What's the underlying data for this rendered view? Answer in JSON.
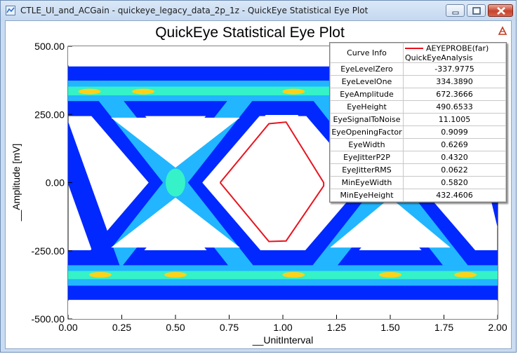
{
  "window": {
    "title": "CTLE_UI_and_ACGain - quickeye_legacy_data_2p_1z - QuickEye Statistical Eye Plot"
  },
  "chart_data": {
    "type": "heatmap",
    "title": "QuickEye Statistical Eye Plot",
    "xlabel": "__UnitInterval",
    "ylabel": "__Amplitude [mV]",
    "xlim": [
      0.0,
      2.0
    ],
    "ylim": [
      -500.0,
      500.0
    ],
    "xticks": [
      "0.00",
      "0.25",
      "0.50",
      "0.75",
      "1.00",
      "1.25",
      "1.50",
      "1.75",
      "2.00"
    ],
    "yticks": [
      "500.00",
      "250.00",
      "0.00",
      "-250.00",
      "-500.00"
    ],
    "grid": false,
    "colors": {
      "background": "#ffffff",
      "level_low": "#0028ff",
      "level_mid": "#21b6ff",
      "level_high": "#35f2c8",
      "level_peak": "#ffd21a",
      "contour": "#e8141f"
    },
    "series": [
      {
        "name": "AEYEPROBE(far)",
        "type": "contour",
        "x": [
          0.708,
          0.935,
          1.015,
          1.19,
          1.19,
          1.015,
          0.935,
          0.708
        ],
        "y": [
          0.0,
          216.0,
          222.0,
          0.0,
          -12.0,
          -214.0,
          -216.0,
          0.0
        ]
      }
    ],
    "legend": {
      "position": "top-right",
      "entry": "AEYEPROBE(far)",
      "sub_entry": "QuickEyeAnalysis"
    }
  },
  "info_table": {
    "header_label": "Curve Info",
    "rows": [
      {
        "name": "EyeLevelZero",
        "value": "-337.9775"
      },
      {
        "name": "EyeLevelOne",
        "value": "334.3890"
      },
      {
        "name": "EyeAmplitude",
        "value": "672.3666"
      },
      {
        "name": "EyeHeight",
        "value": "490.6533"
      },
      {
        "name": "EyeSignalToNoise",
        "value": "11.1005"
      },
      {
        "name": "EyeOpeningFactor",
        "value": "0.9099"
      },
      {
        "name": "EyeWidth",
        "value": "0.6269"
      },
      {
        "name": "EyeJitterP2P",
        "value": "0.4320"
      },
      {
        "name": "EyeJitterRMS",
        "value": "0.0622"
      },
      {
        "name": "MinEyeWidth",
        "value": "0.5820"
      },
      {
        "name": "MinEyeHeight",
        "value": "432.4606"
      }
    ]
  }
}
